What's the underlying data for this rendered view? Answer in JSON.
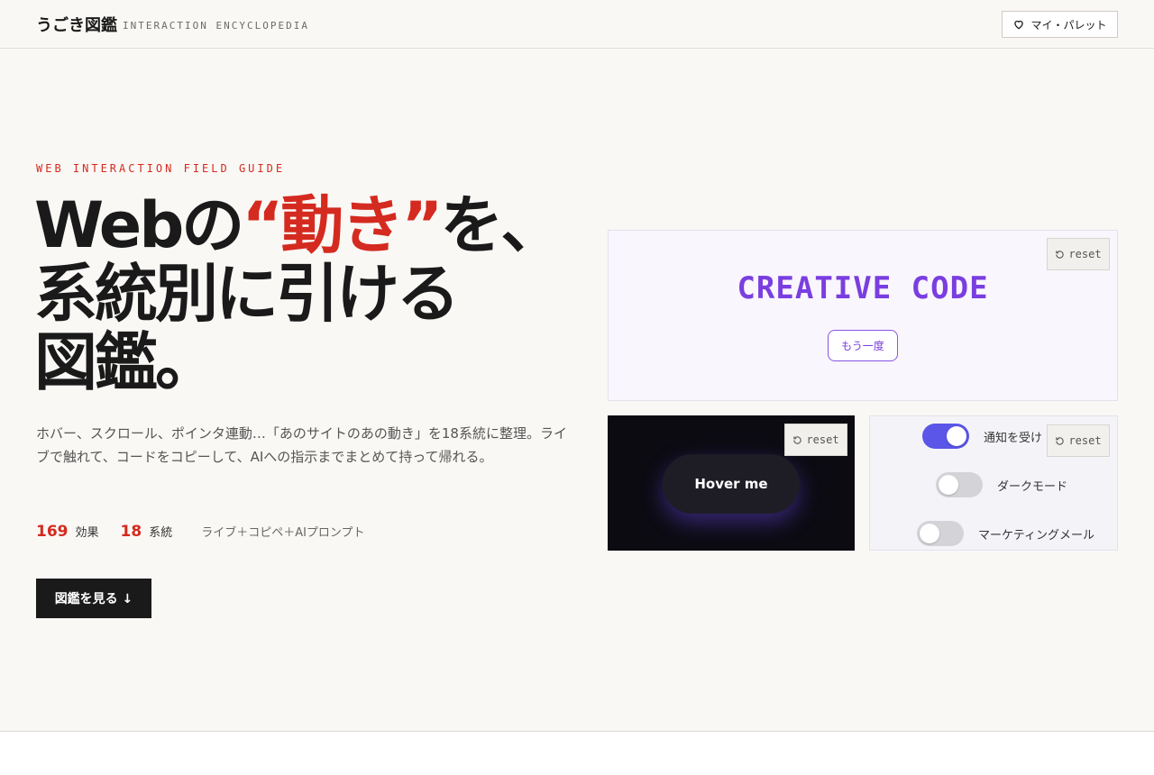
{
  "header": {
    "logo": "うごき図鑑",
    "logo_sub": "INTERACTION ENCYCLOPEDIA",
    "palette_label": "マイ・パレット"
  },
  "hero": {
    "eyebrow": "WEB INTERACTION FIELD GUIDE",
    "headline_before": "Webの",
    "headline_accent": "“動き”",
    "headline_after": "を、",
    "headline_line2": "系統別に引ける",
    "headline_line3": "図鑑。",
    "lead": "ホバー、スクロール、ポインタ連動…「あのサイトのあの動き」を18系統に整理。ライブで触れて、コードをコピーして、AIへの指示までまとめて持って帰れる。",
    "stats": [
      {
        "num": "169",
        "label": "効果"
      },
      {
        "num": "18",
        "label": "系統"
      }
    ],
    "stat_note": "ライブ＋コピペ＋AIプロンプト",
    "cta_label": "図鑑を見る ↓"
  },
  "demos": {
    "creative_text": "CREATIVE CODE",
    "again_label": "もう一度",
    "reset_label": "reset",
    "hover_label": "Hover me",
    "toggles": [
      {
        "label": "通知を受け",
        "on": true
      },
      {
        "label": "ダークモード",
        "on": false
      },
      {
        "label": "マーケティングメール",
        "on": false
      }
    ]
  },
  "colors": {
    "accent": "#d42a1f",
    "purple": "#7a3ee0",
    "toggle_on": "#5b55e8",
    "dark": "#1a1a1a"
  }
}
